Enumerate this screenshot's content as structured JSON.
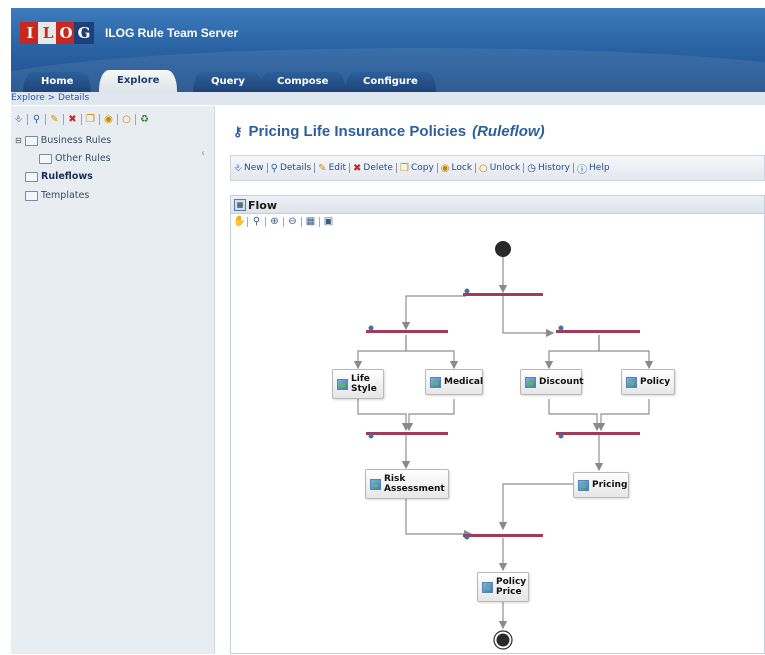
{
  "app": {
    "logo_letters": [
      "I",
      "L",
      "O",
      "G"
    ],
    "title": "ILOG Rule Team Server"
  },
  "tabs": [
    {
      "label": "Home"
    },
    {
      "label": "Explore"
    },
    {
      "label": "Query"
    },
    {
      "label": "Compose"
    },
    {
      "label": "Configure"
    }
  ],
  "breadcrumb": "Explore > Details",
  "left_toolbar_icons": [
    "new-icon",
    "search-icon",
    "edit-icon",
    "delete-icon",
    "copy-icon",
    "lock-icon",
    "unlock-icon",
    "history-icon"
  ],
  "tree": {
    "business_rules": "Business Rules",
    "other_rules": "Other Rules",
    "ruleflows": "Ruleflows",
    "templates": "Templates"
  },
  "page": {
    "title": "Pricing Life Insurance Policies",
    "subtitle": "(Ruleflow)"
  },
  "actions": {
    "new": "New",
    "details": "Details",
    "edit": "Edit",
    "delete": "Delete",
    "copy": "Copy",
    "lock": "Lock",
    "unlock": "Unlock",
    "history": "History",
    "help": "Help"
  },
  "flow": {
    "label": "Flow",
    "nodes": {
      "life_style": [
        "Life",
        "Style"
      ],
      "medical": "Medical",
      "discount": "Discount",
      "policy": "Policy",
      "risk": [
        "Risk",
        "Assessment"
      ],
      "pricing": "Pricing",
      "policy_price": [
        "Policy",
        "Price"
      ]
    }
  },
  "colors": {
    "header": "#2a64a4",
    "accent": "#2d5f9a",
    "fork_bar": "#a03c5a",
    "link": "#1f5ca6"
  }
}
